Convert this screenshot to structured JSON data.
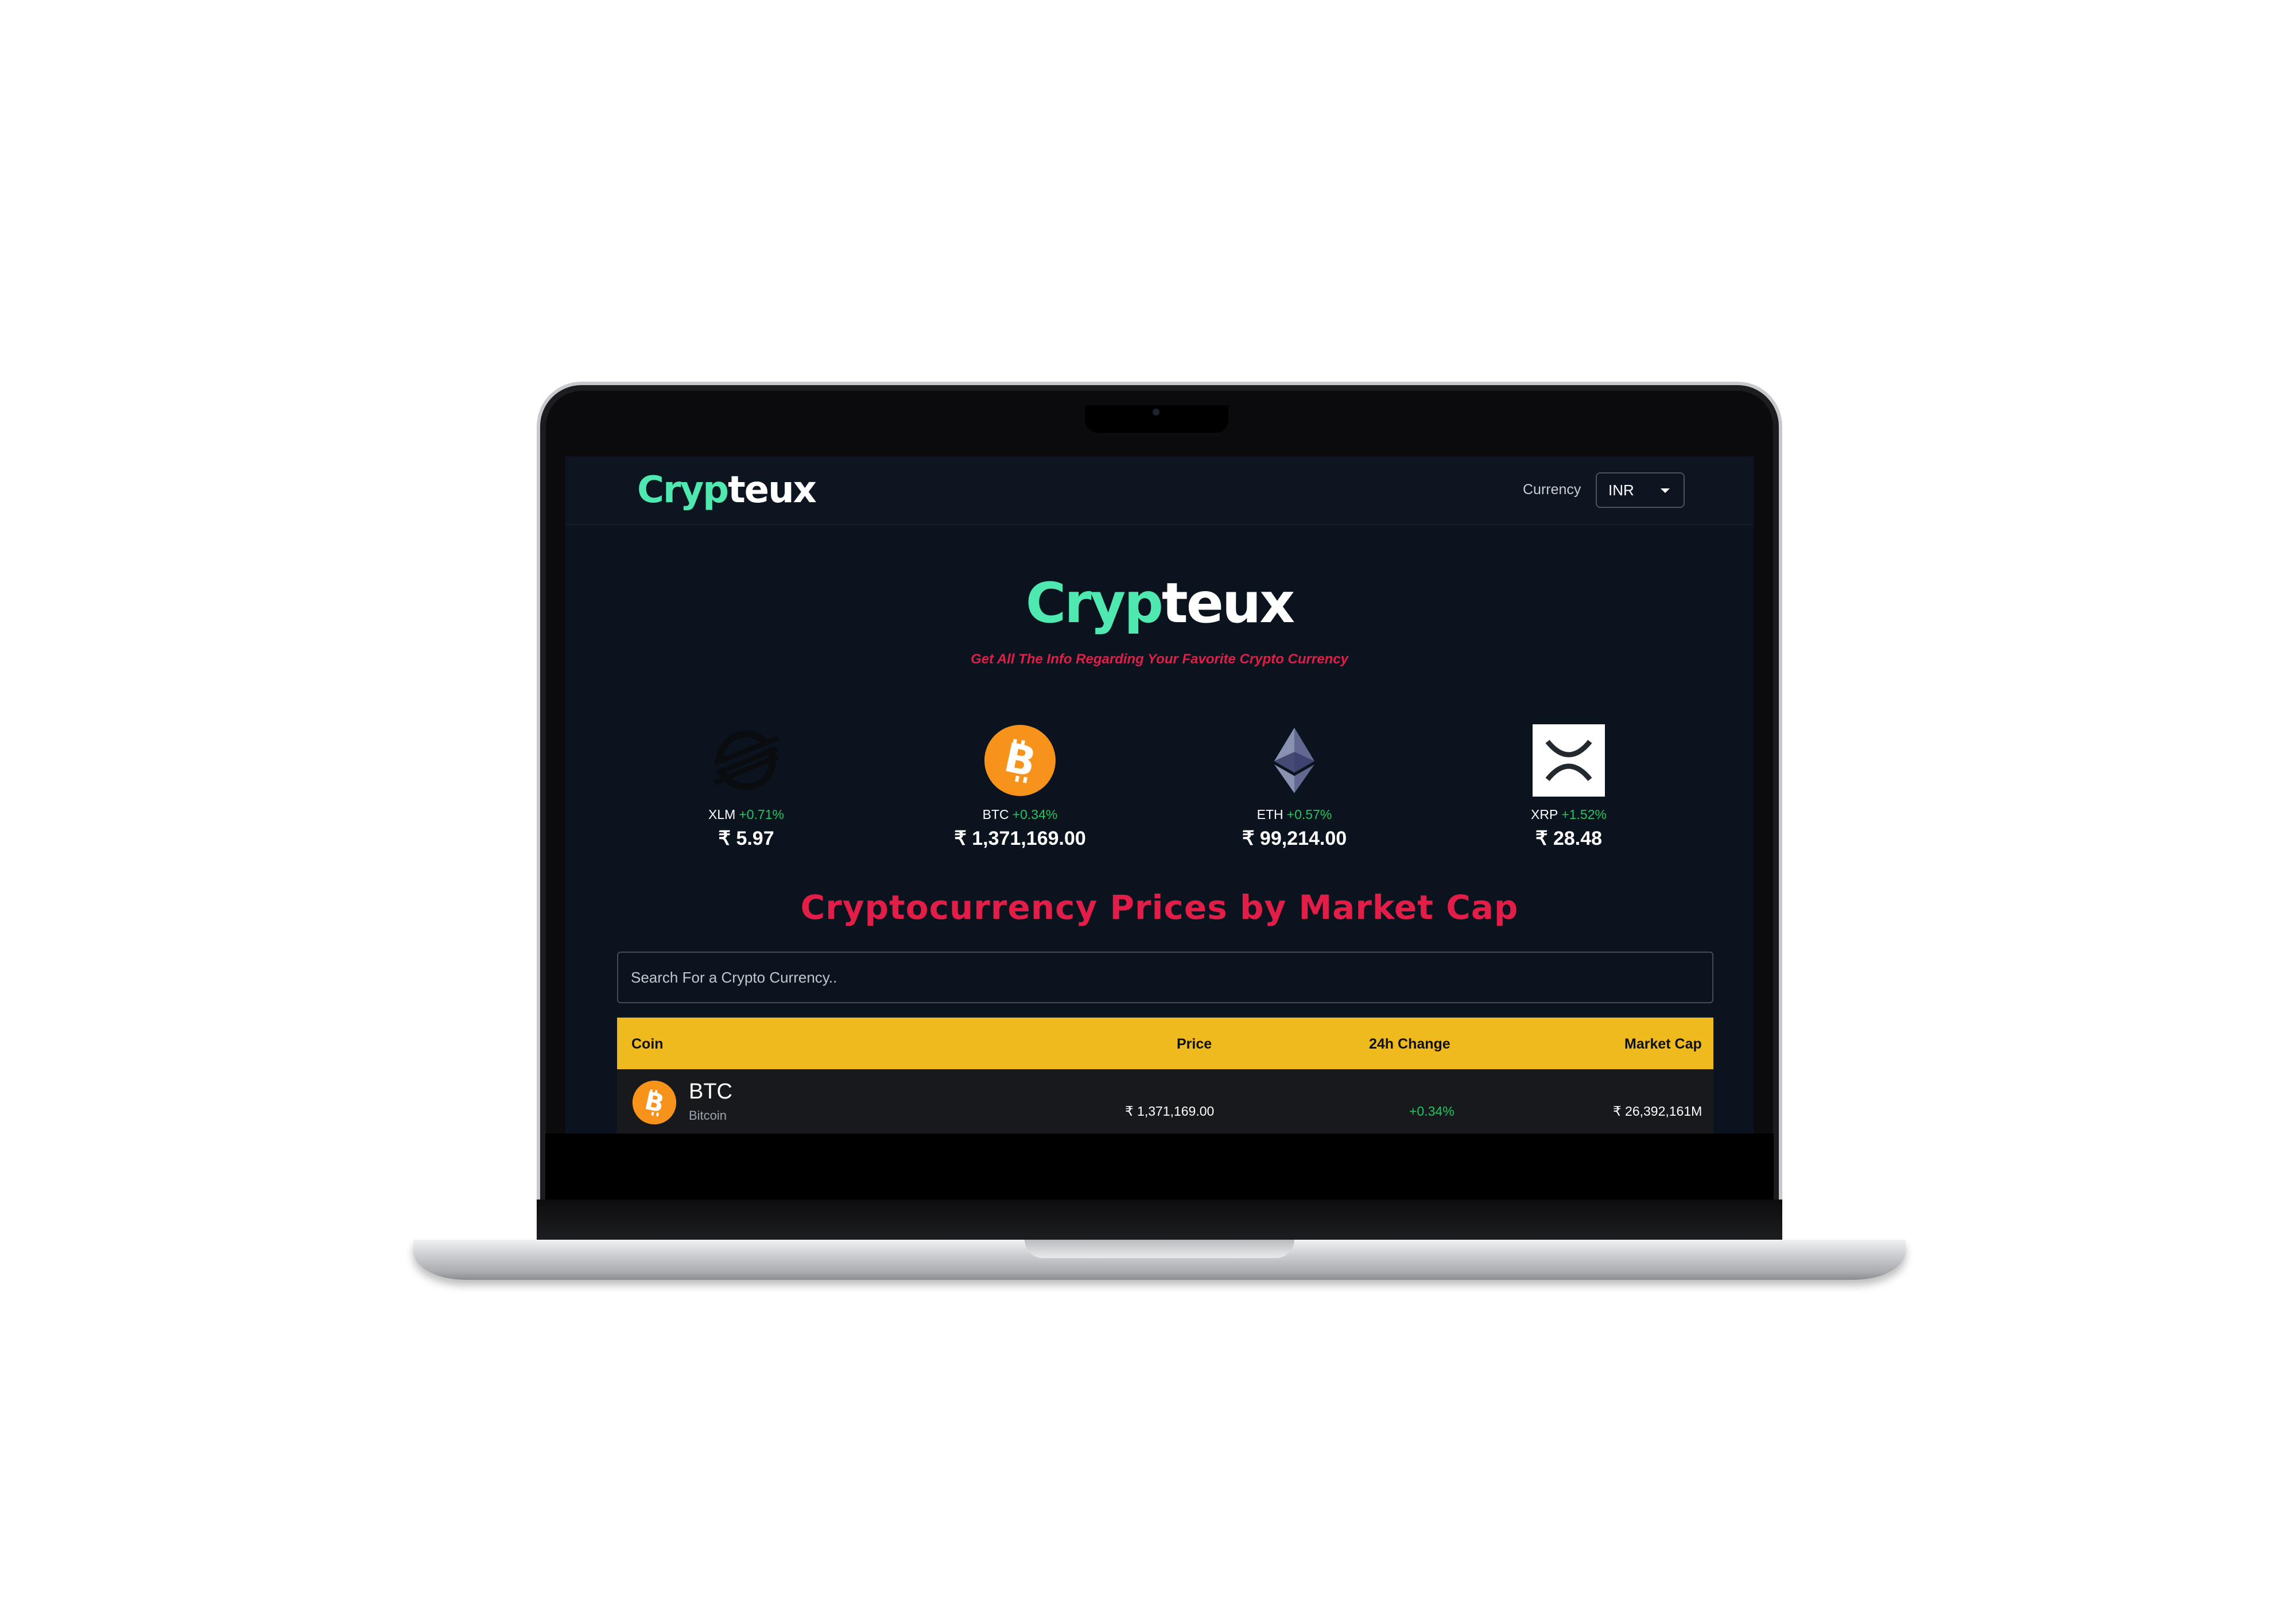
{
  "app": {
    "brand_part1": "Cryp",
    "brand_part2": "teux"
  },
  "header": {
    "currency_label": "Currency",
    "currency_value": "INR"
  },
  "hero": {
    "tagline": "Get All The Info Regarding Your Favorite Crypto Currency"
  },
  "trending": [
    {
      "symbol": "XLM",
      "change": "+0.71%",
      "price": "₹ 5.97",
      "icon": "stellar-icon"
    },
    {
      "symbol": "BTC",
      "change": "+0.34%",
      "price": "₹ 1,371,169.00",
      "icon": "bitcoin-icon"
    },
    {
      "symbol": "ETH",
      "change": "+0.57%",
      "price": "₹ 99,214.00",
      "icon": "ethereum-icon"
    },
    {
      "symbol": "XRP",
      "change": "+1.52%",
      "price": "₹ 28.48",
      "icon": "xrp-icon"
    }
  ],
  "market": {
    "title": "Cryptocurrency Prices by Market Cap",
    "search_placeholder": "Search For a Crypto Currency..",
    "columns": [
      "Coin",
      "Price",
      "24h Change",
      "Market Cap"
    ],
    "rows": [
      {
        "symbol": "BTC",
        "name": "Bitcoin",
        "price": "₹ 1,371,169.00",
        "change": "+0.34%",
        "market_cap": "₹ 26,392,161M",
        "icon": "bitcoin-icon"
      }
    ]
  },
  "colors": {
    "accent_green": "#4ee8b0",
    "accent_red": "#e11d48",
    "table_header": "#eeba1d",
    "positive": "#22c55e",
    "background": "#0b141e"
  }
}
